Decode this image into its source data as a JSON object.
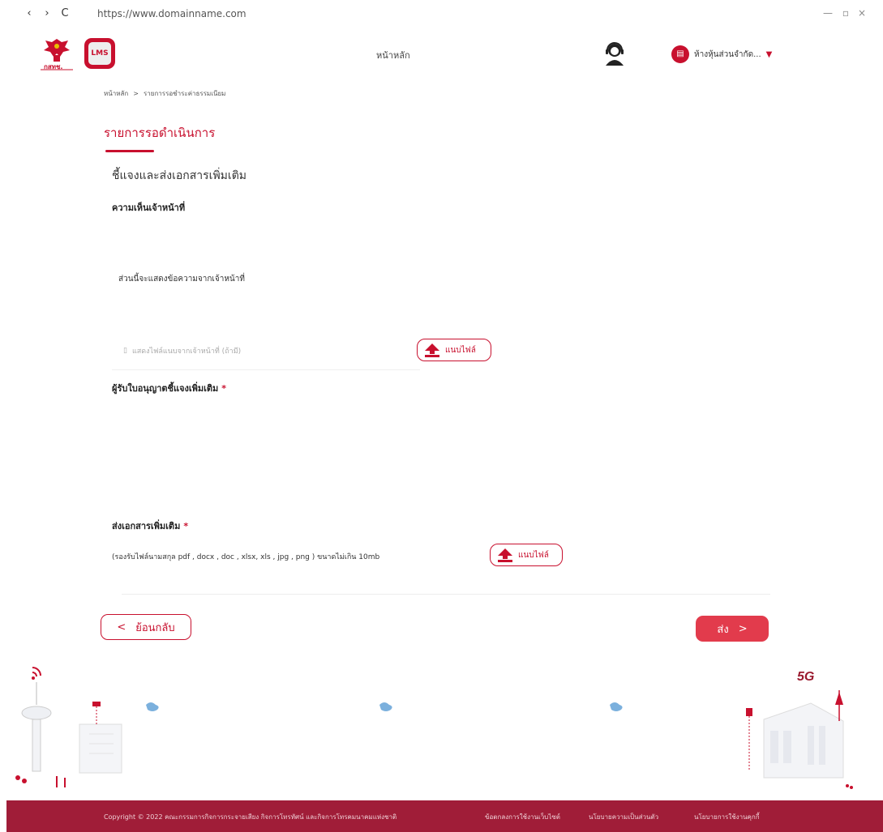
{
  "browser": {
    "url": "https://www.domainname.com",
    "back_icon": "‹",
    "forward_icon": "›",
    "reload_icon": "C",
    "minimize": "—",
    "restore": "▫",
    "close": "×"
  },
  "header": {
    "logo_text": "กสทช.",
    "lms_text": "LMS",
    "nav_home": "หน้าหลัก",
    "user_name": "ห้างหุ้นส่วนจำกัด...",
    "caret": "▼"
  },
  "breadcrumb": {
    "home": "หน้าหลัก",
    "separator": ">",
    "current": "รายการรอชำระค่าธรรมเนียม"
  },
  "page": {
    "title": "รายการรอดำเนินการ",
    "section_heading": "ชี้แจงและส่งเอกสารเพิ่มเติม",
    "officer_label": "ความเห็นเจ้าหน้าที่",
    "officer_message": "ส่วนนี้จะแสดงข้อความจากเจ้าหน้าที่",
    "officer_file": "แสดงไฟล์แนบจากเจ้าหน้าที่ (ถ้ามี)",
    "upload_label": "แนบไฟล์",
    "applicant_label": "ผู้รับใบอนุญาตชี้แจงเพิ่มเติม",
    "required_mark": "*",
    "extra_docs_label": "ส่งเอกสารเพิ่มเติม",
    "extra_docs_desc": "(รองรับไฟล์นามสกุล pdf , docx , doc , xlsx, xls , jpg , png ) ขนาดไม่เกิน 10mb"
  },
  "actions": {
    "back_label": "ย้อนกลับ",
    "back_chevron": "<",
    "submit_label": "ส่ง",
    "submit_chevron": ">"
  },
  "illustration": {
    "badge_5g": "5G"
  },
  "footer": {
    "copyright": "Copyright © 2022 คณะกรรมการกิจการกระจายเสียง กิจการโทรทัศน์ และกิจการโทรคมนาคมแห่งชาติ",
    "terms": "ข้อตกลงการใช้งานเว็บไซต์",
    "privacy": "นโยบายความเป็นส่วนตัว",
    "cookies": "นโยบายการใช้งานคุกกี้"
  },
  "colors": {
    "brand": "#c8102e",
    "submit": "#e23b4c",
    "footer": "#a01d38"
  }
}
